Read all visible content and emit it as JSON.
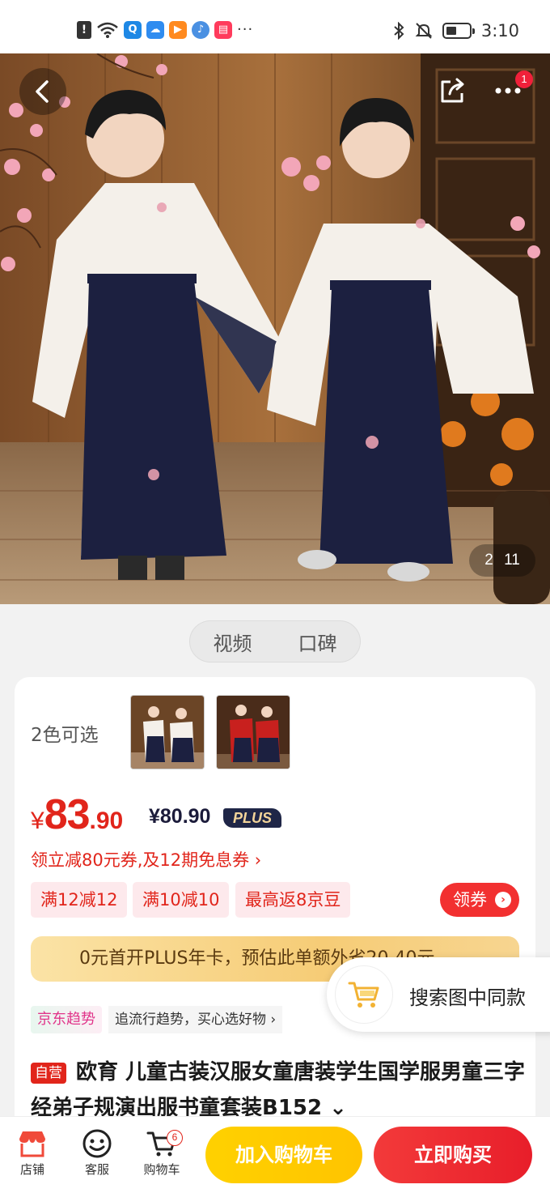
{
  "status_bar": {
    "time": "3:10",
    "notification_icons": [
      "alert-icon",
      "wifi-icon",
      "search-app-icon",
      "cloud-app-icon",
      "video-app-icon",
      "music-app-icon",
      "shop-app-icon"
    ],
    "more": "···"
  },
  "gallery": {
    "index": "2",
    "total": "11",
    "more_badge": "1"
  },
  "media_tabs": {
    "video": "视频",
    "reviews": "口碑"
  },
  "product": {
    "color_label": "2色可选",
    "price_currency": "¥",
    "price_int": "83",
    "price_dec": ".90",
    "plus_price": "¥80.90",
    "plus_tag": "PLUS",
    "coupon_line": "领立减80元券,及12期免息券 ›",
    "tags": [
      "满12减12",
      "满10减10",
      "最高返8京豆"
    ],
    "get_coupon": "领券",
    "plus_banner": "0元首开PLUS年卡，预估此单额外省20.40元",
    "trend_badge": "京东趋势",
    "trend_text": "追流行趋势，买心选好物 ›",
    "self_tag": "自营",
    "title": "欧育 儿童古装汉服女童唐装学生国学服男童三字经弟子规演出服书童套装B152 ⌄"
  },
  "float_search": {
    "label": "搜索图中同款"
  },
  "bottom_bar": {
    "shop": "店铺",
    "service": "客服",
    "cart": "购物车",
    "cart_count": "6",
    "add_to_cart": "加入购物车",
    "buy_now": "立即购买"
  },
  "colors": {
    "accent_red": "#e1251b",
    "add_cart_yellow": "#ffc400",
    "buy_red": "#e81e2a",
    "plus_navy": "#1f2647"
  }
}
